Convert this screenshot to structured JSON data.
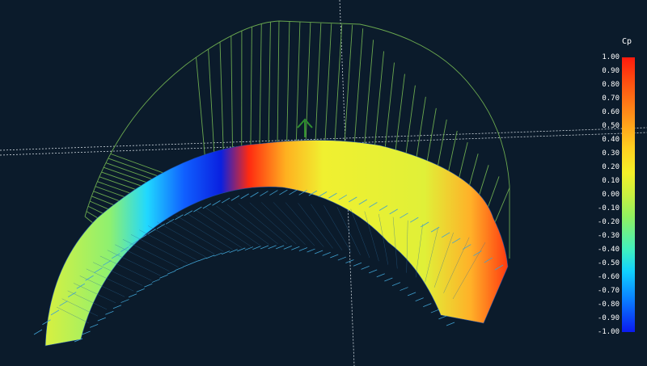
{
  "colorbar": {
    "title": "Cp",
    "ticks": [
      "1.00",
      "0.90",
      "0.80",
      "0.70",
      "0.60",
      "0.50",
      "0.40",
      "0.30",
      "0.20",
      "0.10",
      "0.00",
      "-0.10",
      "-0.20",
      "-0.30",
      "-0.40",
      "-0.50",
      "-0.60",
      "-0.70",
      "-0.80",
      "-0.90",
      "-1.00"
    ],
    "min": -1.0,
    "max": 1.0
  },
  "colors": {
    "background": "#0b1b2b",
    "grid_line": "#cfd8df",
    "pressure_envelope": "#6aa84f",
    "vectors": "#3fa0d0",
    "axis_arrow": "#2f8f2f"
  }
}
